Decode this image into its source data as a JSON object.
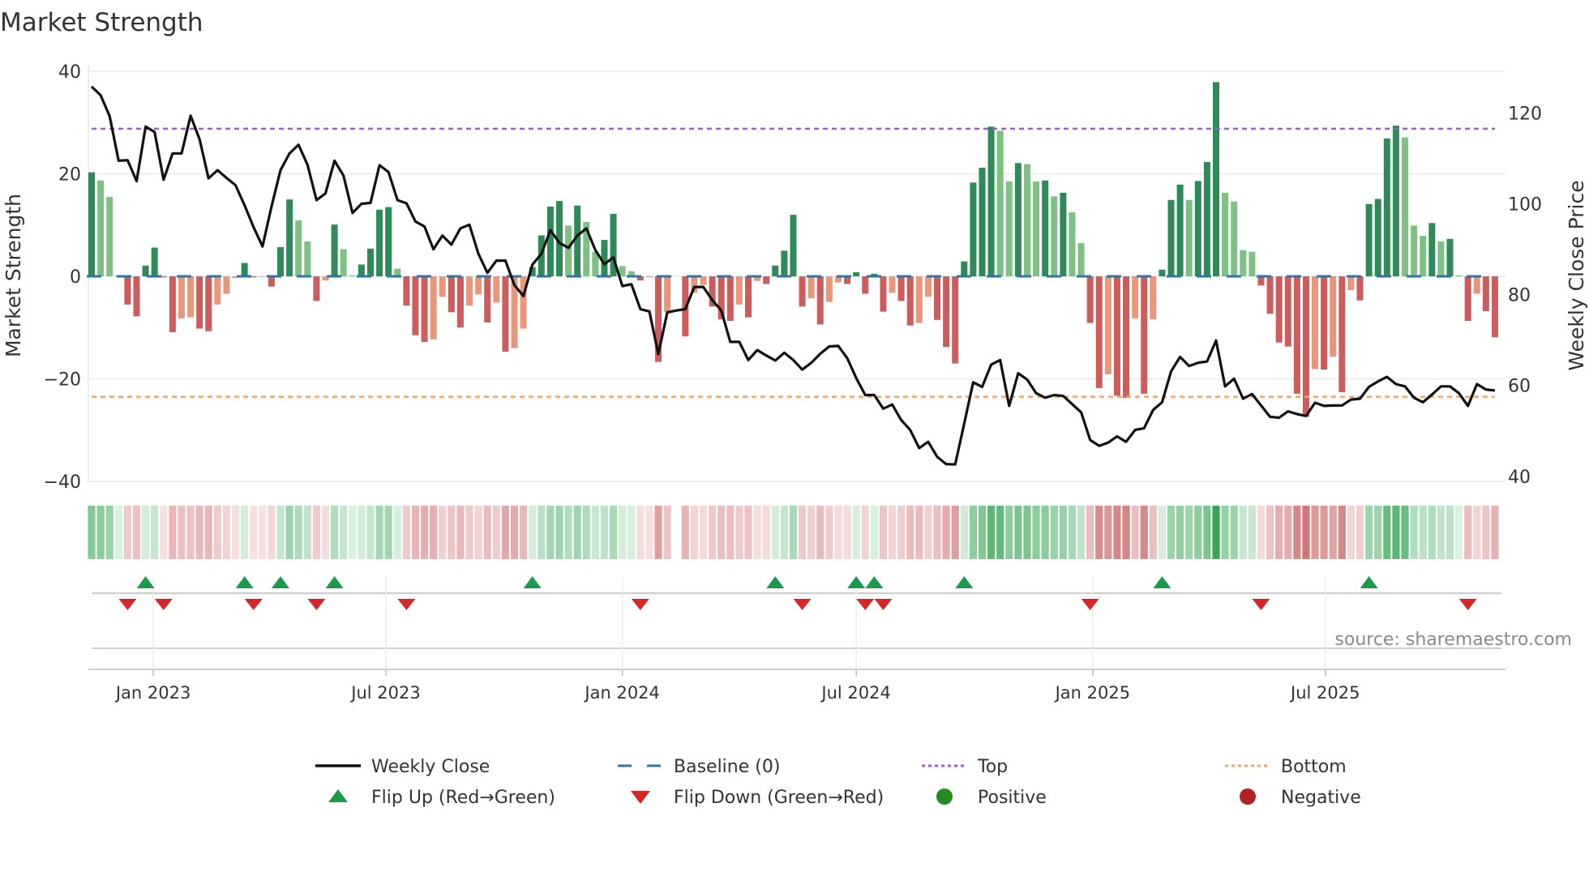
{
  "title": "Market Strength",
  "source": "source: sharemaestro.com",
  "chart_data": {
    "type": "bar+line",
    "title": "Market Strength",
    "x_start": "2022-11-14",
    "x_freq": "weekly",
    "ylabel": "Market Strength",
    "y2label": "Weekly Close Price",
    "ylim": [
      -40,
      40
    ],
    "y2lim": [
      39,
      129
    ],
    "yticks": [
      {
        "v": 40,
        "label": "40"
      },
      {
        "v": 20,
        "label": "20"
      },
      {
        "v": 0,
        "label": "0"
      },
      {
        "v": -20,
        "label": "−20"
      },
      {
        "v": -40,
        "label": "−40"
      }
    ],
    "y2ticks": [
      {
        "v": 40,
        "label": "40"
      },
      {
        "v": 60,
        "label": "60"
      },
      {
        "v": 80,
        "label": "80"
      },
      {
        "v": 100,
        "label": "100"
      },
      {
        "v": 120,
        "label": "120"
      }
    ],
    "xticks": [
      {
        "date": "2023-01-01",
        "label": "Jan 2023"
      },
      {
        "date": "2023-07-01",
        "label": "Jul 2023"
      },
      {
        "date": "2024-01-01",
        "label": "Jan 2024"
      },
      {
        "date": "2024-07-01",
        "label": "Jul 2024"
      },
      {
        "date": "2025-01-01",
        "label": "Jan 2025"
      },
      {
        "date": "2025-07-01",
        "label": "Jul 2025"
      }
    ],
    "top_level": 28.8,
    "bottom_level": -23.5,
    "baseline": 0,
    "strength": [
      20.3,
      18.7,
      15.5,
      0.2,
      -5.5,
      -7.8,
      2.1,
      5.6,
      -0.2,
      -10.9,
      -8.2,
      -8.0,
      -10.2,
      -10.7,
      -5.5,
      -3.4,
      -0.3,
      2.6,
      -0.2,
      -0.1,
      -2.0,
      5.7,
      15.0,
      10.9,
      6.8,
      -4.8,
      -0.8,
      10.1,
      5.3,
      0.2,
      2.3,
      5.4,
      13.0,
      13.5,
      1.5,
      -5.7,
      -11.5,
      -12.8,
      -12.3,
      -4.0,
      -7.0,
      -10.0,
      -5.7,
      -3.5,
      -9.0,
      -5.1,
      -14.7,
      -14.0,
      -10.2,
      1.8,
      8.0,
      13.6,
      14.7,
      9.9,
      13.8,
      10.6,
      4.8,
      7.1,
      12.2,
      2.0,
      1.0,
      -0.8,
      -0.2,
      -16.7,
      -7.0,
      null,
      -11.7,
      -3.2,
      -1.7,
      -5.9,
      -8.4,
      -8.7,
      -5.5,
      -8.0,
      -0.9,
      -1.5,
      2.1,
      5.0,
      12.0,
      -5.9,
      -4.3,
      -9.4,
      -5.0,
      -1.2,
      -1.5,
      0.8,
      -3.4,
      0.5,
      -6.9,
      -3.2,
      -4.8,
      -9.6,
      -9.1,
      -4.0,
      -8.5,
      -13.8,
      -17.0,
      2.9,
      18.3,
      21.2,
      29.2,
      28.4,
      18.5,
      22.1,
      21.9,
      18.5,
      18.7,
      15.6,
      16.3,
      12.5,
      6.5,
      -9.1,
      -21.8,
      -19.1,
      -23.3,
      -23.7,
      -8.2,
      -22.9,
      -8.4,
      1.3,
      14.9,
      17.9,
      14.9,
      18.6,
      22.3,
      37.9,
      16.3,
      14.6,
      5.1,
      4.8,
      -1.8,
      -7.3,
      -12.9,
      -13.7,
      -22.9,
      -27.4,
      -18.1,
      -18.2,
      -15.7,
      -22.6,
      -2.7,
      -4.7,
      14.1,
      15.1,
      26.9,
      29.4,
      27.1,
      9.9,
      7.9,
      10.4,
      6.8,
      7.3,
      0.2,
      -8.7,
      -3.4,
      -6.8,
      -11.9
    ],
    "weekly_close": [
      125.8,
      123.9,
      119.3,
      109.5,
      109.6,
      105.0,
      117.0,
      115.8,
      105.3,
      111.1,
      111.1,
      119.4,
      114.2,
      105.6,
      107.4,
      105.7,
      104.1,
      99.7,
      94.9,
      90.6,
      99.4,
      107.4,
      111.1,
      113.0,
      108.6,
      100.8,
      102.3,
      109.5,
      106.2,
      98.0,
      100.0,
      100.2,
      108.5,
      107.0,
      100.8,
      100.1,
      96.1,
      95.0,
      90.0,
      93.0,
      91.0,
      94.6,
      95.4,
      89.0,
      84.8,
      87.5,
      87.5,
      82.1,
      79.7,
      86.6,
      89.0,
      94.2,
      91.4,
      90.3,
      93.0,
      94.6,
      89.8,
      86.7,
      88.2,
      81.9,
      82.3,
      76.8,
      76.3,
      66.9,
      76.1,
      76.5,
      76.8,
      81.7,
      81.7,
      78.8,
      76.5,
      69.6,
      69.6,
      65.6,
      67.8,
      66.6,
      65.5,
      67.2,
      65.6,
      63.5,
      65.0,
      67.0,
      68.6,
      68.7,
      66.0,
      61.6,
      57.9,
      57.9,
      54.9,
      55.8,
      52.4,
      50.2,
      46.2,
      47.6,
      44.3,
      42.7,
      42.6,
      51.6,
      60.7,
      59.7,
      64.6,
      65.6,
      55.5,
      62.7,
      61.3,
      58.3,
      57.3,
      57.9,
      57.7,
      55.9,
      54.1,
      48.0,
      46.7,
      47.4,
      48.8,
      47.6,
      50.2,
      50.6,
      54.6,
      56.3,
      63.1,
      66.3,
      64.3,
      65.0,
      65.3,
      69.9,
      59.8,
      61.5,
      57.1,
      58.1,
      55.6,
      53.1,
      52.9,
      54.3,
      53.7,
      53.3,
      56.2,
      55.5,
      55.6,
      55.6,
      56.9,
      57.1,
      59.7,
      60.9,
      61.9,
      60.3,
      59.8,
      57.3,
      56.3,
      58.0,
      59.8,
      59.8,
      58.3,
      55.5,
      60.3,
      59.1,
      58.9
    ],
    "flip_up_indices": [
      6,
      17,
      21,
      27,
      49,
      76,
      85,
      87,
      97,
      119,
      142
    ],
    "flip_down_indices": [
      4,
      8,
      18,
      25,
      35,
      61,
      79,
      86,
      88,
      111,
      130,
      153
    ],
    "legend_position": "bottom",
    "legend": [
      {
        "key": "close",
        "label": "Weekly Close"
      },
      {
        "key": "baseline",
        "label": "Baseline (0)"
      },
      {
        "key": "top",
        "label": "Top"
      },
      {
        "key": "bottom",
        "label": "Bottom"
      },
      {
        "key": "flip_up",
        "label": "Flip Up (Red→Green)"
      },
      {
        "key": "flip_down",
        "label": "Flip Down (Green→Red)"
      },
      {
        "key": "positive",
        "label": "Positive"
      },
      {
        "key": "negative",
        "label": "Negative"
      }
    ],
    "colors": {
      "green_rising": "#2e8b57",
      "green_falling": "#7fc184",
      "red_falling": "#cd5c5c",
      "red_rising": "#e9967a",
      "close": "#111111",
      "baseline": "#2f75a8",
      "top": "#9d5ce0",
      "bottom": "#f0a664",
      "flip_up": "#1a9a4a",
      "flip_down": "#d62728",
      "positive": "#228b22",
      "negative": "#b22222"
    }
  }
}
